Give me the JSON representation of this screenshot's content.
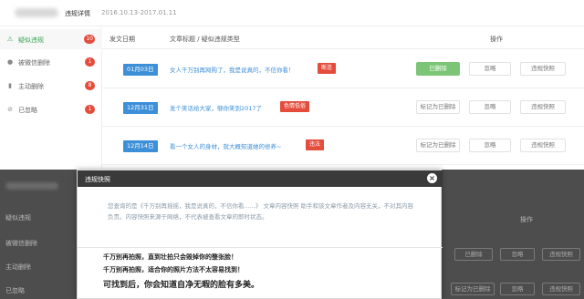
{
  "header": {
    "breadcrumb": "违规详情",
    "date_range": "2016.10.13-2017.01.11"
  },
  "sidebar": {
    "items": [
      {
        "label": "疑似违规",
        "badge": "10",
        "icon": "⚠"
      },
      {
        "label": "被微信删除",
        "badge": "1",
        "icon": "●"
      },
      {
        "label": "主动删除",
        "badge": "8",
        "icon": "▮"
      },
      {
        "label": "已忽略",
        "badge": "1",
        "icon": "⊘"
      }
    ]
  },
  "table": {
    "headers": {
      "date": "发文日期",
      "title": "文章标题 / 疑似违规类型",
      "action": "操作"
    },
    "rows": [
      {
        "date": "01月03日",
        "title": "女人千万别再网购了，我是说真的，不信你看！",
        "tag": "断连",
        "actions": [
          "已删除",
          "忽略",
          "违规快照"
        ]
      },
      {
        "date": "12月31日",
        "title": "发个笑话给大家，够你笑到2017了",
        "tag": "色情低俗",
        "actions": [
          "标记为已删除",
          "忽略",
          "违规快照"
        ]
      },
      {
        "date": "12月14日",
        "title": "看一个女人的身材，就大概知道她的修养~",
        "tag": "违法",
        "actions": [
          "标记为已删除",
          "忽略",
          "违规快照"
        ]
      }
    ]
  },
  "background": {
    "sidebar": [
      "疑似违规",
      "被微信删除",
      "主动删除",
      "已忽略"
    ],
    "header": "操作",
    "buttons": [
      "已删除",
      "忽略",
      "违规快照",
      "标记为已删除"
    ]
  },
  "modal": {
    "title": "违规快照",
    "desc": "您查询的是《千万别再摇摇，我是说真的，不信你看......》 文章内容快照 助手和该文章作者及内容无关，不对其内容负责。内容快照来源于网络，不代表被查看文章的即时状态。",
    "body": [
      "千万别再拍照，直到壮拍只会毁掉你的整张脸！",
      "千万别再拍照，适合你的照片方法不太容易找到！",
      "可找到后，你会知道自净无暇的脸有多美。"
    ]
  },
  "colors": {
    "accent_blue": "#3d8fd8",
    "badge_red": "#e44c3c",
    "green": "#7cc576",
    "modal_header": "#3a3a3a"
  }
}
